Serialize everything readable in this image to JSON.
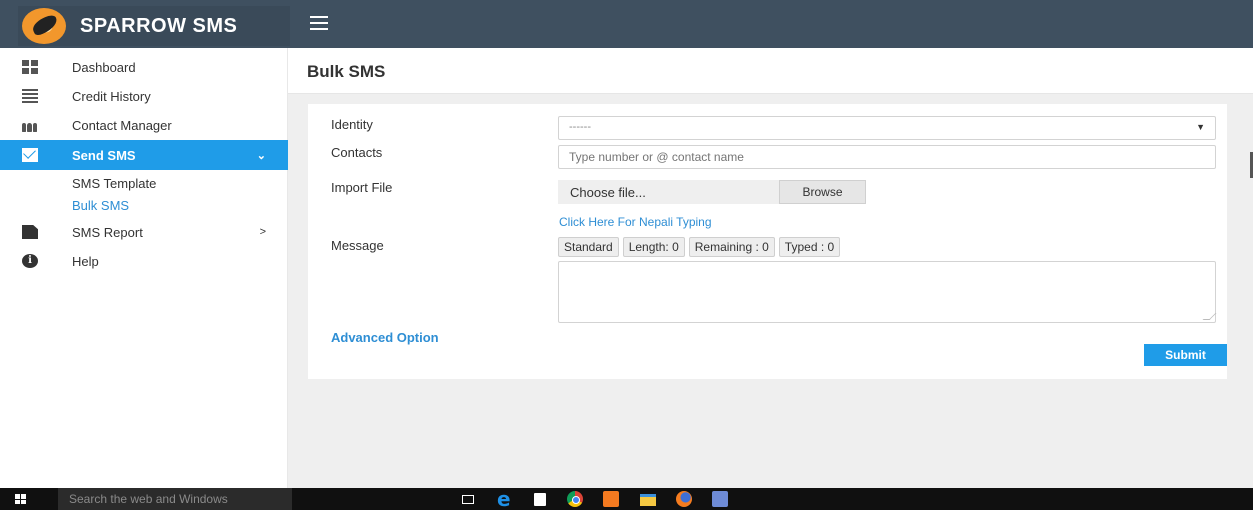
{
  "app": {
    "brand": "SPARROW SMS"
  },
  "sidebar": {
    "items": [
      {
        "label": "Dashboard",
        "icon": "dashboard-icon"
      },
      {
        "label": "Credit History",
        "icon": "list-icon"
      },
      {
        "label": "Contact Manager",
        "icon": "users-icon"
      },
      {
        "label": "Send SMS",
        "icon": "envelope-icon",
        "caret": "⌄",
        "active": true
      },
      {
        "label": "SMS Report",
        "icon": "file-icon",
        "caret": ">"
      },
      {
        "label": "Help",
        "icon": "info-icon"
      }
    ],
    "sub_items": [
      {
        "label": "SMS Template"
      },
      {
        "label": "Bulk SMS",
        "current": true
      }
    ]
  },
  "page": {
    "title": "Bulk SMS"
  },
  "form": {
    "identity": {
      "label": "Identity",
      "value": "------"
    },
    "contacts": {
      "label": "Contacts",
      "placeholder": "Type number or @ contact name"
    },
    "import_file": {
      "label": "Import File",
      "value": "Choose file...",
      "browse_label": "Browse"
    },
    "nepali_link": "Click Here For Nepali Typing",
    "message": {
      "label": "Message",
      "tags": [
        "Standard",
        "Length: 0",
        "Remaining : 0",
        "Typed : 0"
      ]
    },
    "advanced_label": "Advanced Option",
    "submit_label": "Submit"
  },
  "taskbar": {
    "search_placeholder": "Search the web and Windows",
    "apps": [
      "task-view-icon",
      "edge-icon",
      "store-icon",
      "chrome-icon",
      "xampp-icon",
      "file-explorer-icon",
      "firefox-icon",
      "powerpoint-icon"
    ]
  },
  "colors": {
    "topbar": "#3f5060",
    "accent": "#1f9ce8",
    "link": "#2e8ed4",
    "background": "#efefef"
  }
}
